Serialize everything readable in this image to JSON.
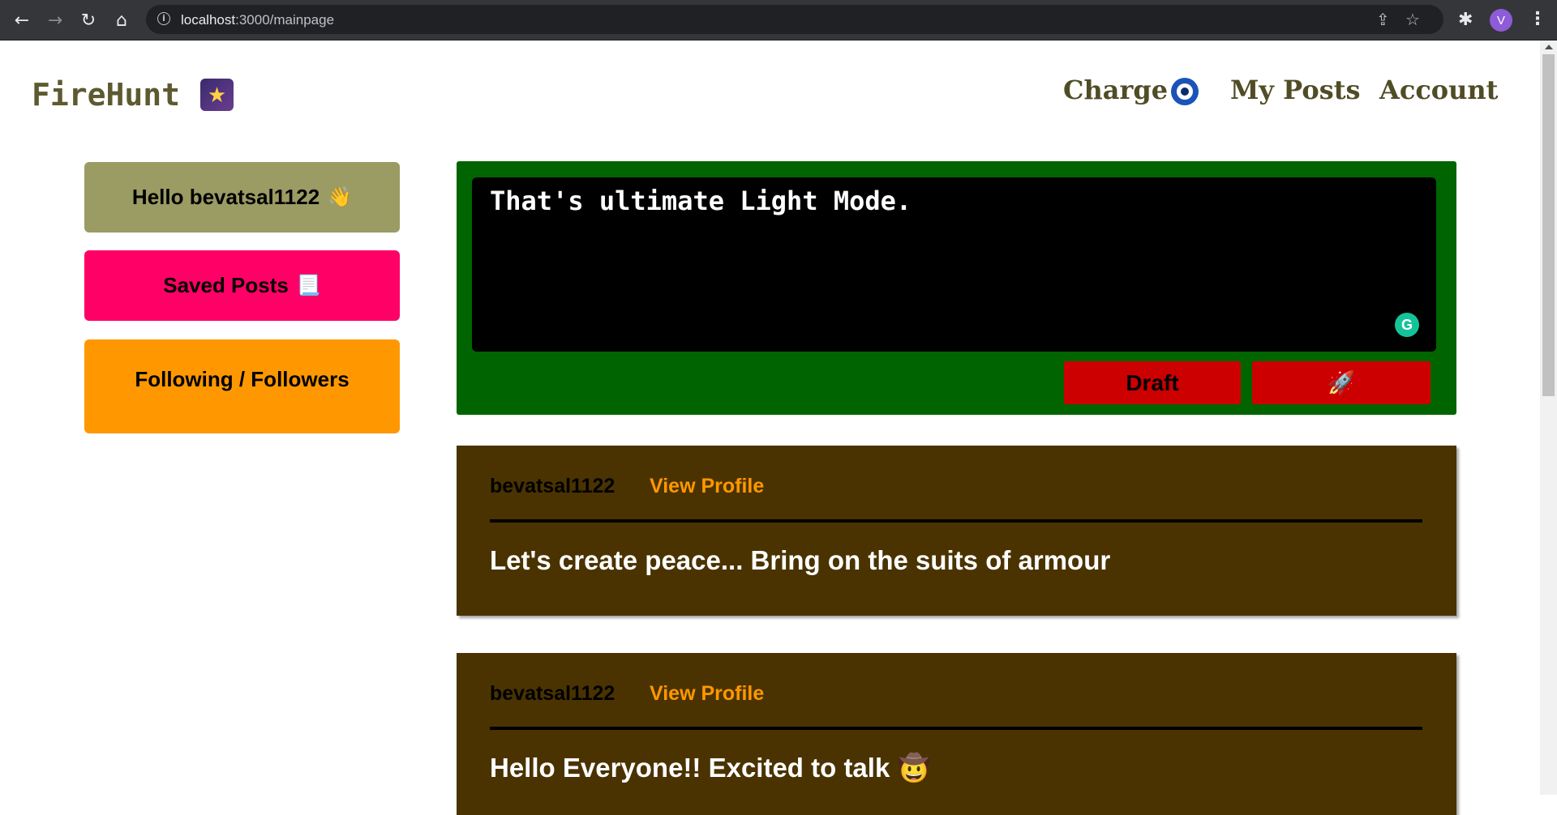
{
  "browser": {
    "url_host": "localhost",
    "url_path": ":3000/mainpage",
    "profile_initial": "V"
  },
  "header": {
    "logo_text": "FireHunt",
    "logo_icon": "shooting-star-icon",
    "nav": {
      "charge": "Charge",
      "my_posts": "My Posts",
      "account": "Account"
    }
  },
  "sidebar": {
    "greeting": "Hello bevatsal1122",
    "greeting_emoji": "👋",
    "saved_posts": "Saved Posts",
    "saved_posts_emoji": "📃",
    "following_followers": "Following / Followers",
    "colors": {
      "greeting": "#9b9b64",
      "saved_posts": "#ff0066",
      "following": "#ff9800"
    }
  },
  "composer": {
    "text": "That's ultimate Light Mode.",
    "draft_label": "Draft",
    "post_emoji": "🚀",
    "colors": {
      "panel": "#006400",
      "input": "#000000",
      "button": "#cc0000"
    }
  },
  "posts": [
    {
      "author": "bevatsal1122",
      "view_profile": "View Profile",
      "content": "Let's create peace... Bring on the suits of armour"
    },
    {
      "author": "bevatsal1122",
      "view_profile": "View Profile",
      "content": "Hello Everyone!! Excited to talk 🤠"
    }
  ]
}
